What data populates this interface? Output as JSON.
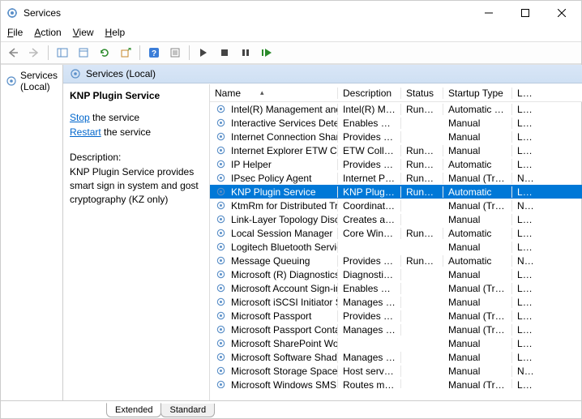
{
  "window": {
    "title": "Services"
  },
  "menus": {
    "file": "File",
    "action": "Action",
    "view": "View",
    "help": "Help"
  },
  "tree": {
    "root": "Services (Local)"
  },
  "header_label": "Services (Local)",
  "selected_service": {
    "name": "KNP Plugin Service",
    "stop_link": "Stop",
    "stop_suffix": " the service",
    "restart_link": "Restart",
    "restart_suffix": " the service",
    "desc_label": "Description:",
    "description": "KNP Plugin Service provides smart sign in system and gost cryptography (KZ only)"
  },
  "columns": {
    "name": "Name",
    "description": "Description",
    "status": "Status",
    "startup": "Startup Type",
    "logon": "Log"
  },
  "tabs": {
    "extended": "Extended",
    "standard": "Standard"
  },
  "services": [
    {
      "name": "Intel(R) Management and S...",
      "desc": "Intel(R) Ma...",
      "status": "Running",
      "startup": "Automatic (D...",
      "logon": "Loc"
    },
    {
      "name": "Interactive Services Detection",
      "desc": "Enables use...",
      "status": "",
      "startup": "Manual",
      "logon": "Loc"
    },
    {
      "name": "Internet Connection Sharin...",
      "desc": "Provides ne...",
      "status": "",
      "startup": "Manual",
      "logon": "Loc"
    },
    {
      "name": "Internet Explorer ETW Colle...",
      "desc": "ETW Collect...",
      "status": "Running",
      "startup": "Manual",
      "logon": "Loc"
    },
    {
      "name": "IP Helper",
      "desc": "Provides tu...",
      "status": "Running",
      "startup": "Automatic",
      "logon": "Loc"
    },
    {
      "name": "IPsec Policy Agent",
      "desc": "Internet Pro...",
      "status": "Running",
      "startup": "Manual (Trig...",
      "logon": "Net"
    },
    {
      "name": "KNP Plugin Service",
      "desc": "KNP Plugin ...",
      "status": "Running",
      "startup": "Automatic",
      "logon": "Loc",
      "selected": true
    },
    {
      "name": "KtmRm for Distributed Tran...",
      "desc": "Coordinates...",
      "status": "",
      "startup": "Manual (Trig...",
      "logon": "Net"
    },
    {
      "name": "Link-Layer Topology Discov...",
      "desc": "Creates a N...",
      "status": "",
      "startup": "Manual",
      "logon": "Loc"
    },
    {
      "name": "Local Session Manager",
      "desc": "Core Windo...",
      "status": "Running",
      "startup": "Automatic",
      "logon": "Loc"
    },
    {
      "name": "Logitech Bluetooth Service",
      "desc": "",
      "status": "",
      "startup": "Manual",
      "logon": "Loc"
    },
    {
      "name": "Message Queuing",
      "desc": "Provides a ...",
      "status": "Running",
      "startup": "Automatic",
      "logon": "Net"
    },
    {
      "name": "Microsoft (R) Diagnostics H...",
      "desc": "Diagnostics ...",
      "status": "",
      "startup": "Manual",
      "logon": "Loc"
    },
    {
      "name": "Microsoft Account Sign-in ...",
      "desc": "Enables use...",
      "status": "",
      "startup": "Manual (Trig...",
      "logon": "Loc"
    },
    {
      "name": "Microsoft iSCSI Initiator Ser...",
      "desc": "Manages In...",
      "status": "",
      "startup": "Manual",
      "logon": "Loc"
    },
    {
      "name": "Microsoft Passport",
      "desc": "Provides pr...",
      "status": "",
      "startup": "Manual (Trig...",
      "logon": "Loc"
    },
    {
      "name": "Microsoft Passport Container",
      "desc": "Manages lo...",
      "status": "",
      "startup": "Manual (Trig...",
      "logon": "Loc"
    },
    {
      "name": "Microsoft SharePoint Works...",
      "desc": "",
      "status": "",
      "startup": "Manual",
      "logon": "Loc"
    },
    {
      "name": "Microsoft Software Shadow...",
      "desc": "Manages so...",
      "status": "",
      "startup": "Manual",
      "logon": "Loc"
    },
    {
      "name": "Microsoft Storage Spaces S...",
      "desc": "Host service...",
      "status": "",
      "startup": "Manual",
      "logon": "Net"
    },
    {
      "name": "Microsoft Windows SMS Ro...",
      "desc": "Routes mes...",
      "status": "",
      "startup": "Manual (Trig...",
      "logon": "Loc"
    }
  ]
}
